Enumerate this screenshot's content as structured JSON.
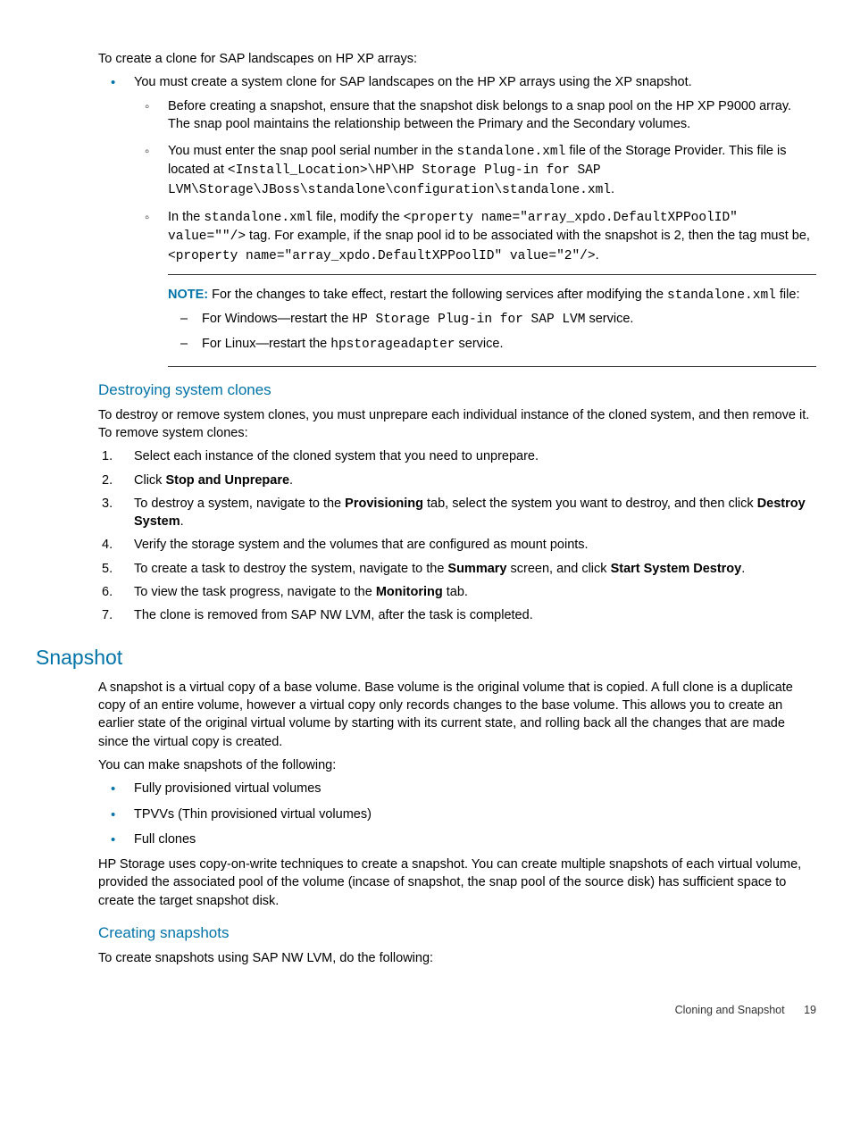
{
  "intro": {
    "p1": "To create a clone for SAP landscapes on HP XP arrays:",
    "b1": "You must create a system clone for SAP landscapes on the HP XP arrays using the XP snapshot.",
    "sub1": "Before creating a snapshot, ensure that the snapshot disk belongs to a snap pool on the HP XP P9000 array. The snap pool maintains the relationship between the Primary and the Secondary volumes.",
    "sub2a": "You must enter the snap pool serial number in the ",
    "sub2_code1": "standalone.xml",
    "sub2b": " file of the Storage Provider. This file is located at ",
    "sub2_code2": "<Install_Location>\\HP\\HP Storage Plug-in for SAP LVM\\Storage\\JBoss\\standalone\\configuration\\standalone.xml",
    "sub2c": ".",
    "sub3a": "In the ",
    "sub3_code1": "standalone.xml",
    "sub3b": " file, modify the ",
    "sub3_code2": "<property name=\"array_xpdo.DefaultXPPoolID\" value=\"\"/>",
    "sub3c": " tag. For example, if the snap pool id to be associated with the snapshot is 2, then the tag must be, ",
    "sub3_code3": "<property name=\"array_xpdo.DefaultXPPoolID\" value=\"2\"/>",
    "sub3d": ".",
    "note_label": "NOTE:",
    "note_text_a": "   For the changes to take effect, restart the following services after modifying the ",
    "note_code": "standalone.xml",
    "note_text_b": " file:",
    "dash1a": "For Windows—restart the ",
    "dash1_code": "HP Storage Plug-in for SAP LVM",
    "dash1b": " service.",
    "dash2a": "For Linux—restart the ",
    "dash2_code": "hpstorageadapter",
    "dash2b": " service."
  },
  "destroy": {
    "heading": "Destroying system clones",
    "p1": "To destroy or remove system clones, you must unprepare each individual instance of the cloned system, and then remove it. To remove system clones:",
    "li1": "Select each instance of the cloned system that you need to unprepare.",
    "li2a": "Click ",
    "li2_bold": "Stop and Unprepare",
    "li2b": ".",
    "li3a": "To destroy a system, navigate to the ",
    "li3_bold1": "Provisioning",
    "li3b": " tab, select the system you want to destroy, and then click ",
    "li3_bold2": "Destroy System",
    "li3c": ".",
    "li4": "Verify the storage system and the volumes that are configured as mount points.",
    "li5a": "To create a task to destroy the system, navigate to the ",
    "li5_bold1": "Summary",
    "li5b": " screen, and click ",
    "li5_bold2": "Start System Destroy",
    "li5c": ".",
    "li6a": "To view the task progress, navigate to the ",
    "li6_bold": "Monitoring",
    "li6b": " tab.",
    "li7": "The clone is removed from SAP NW LVM, after the task is completed."
  },
  "snapshot": {
    "heading": "Snapshot",
    "p1": "A snapshot is a virtual copy of a base volume. Base volume is the original volume that is copied. A full clone is a duplicate copy of an entire volume, however a virtual copy only records changes to the base volume. This allows you to create an earlier state of the original virtual volume by starting with its current state, and rolling back all the changes that are made since the virtual copy is created.",
    "p2": "You can make snapshots of the following:",
    "b1": "Fully provisioned virtual volumes",
    "b2": "TPVVs (Thin provisioned virtual volumes)",
    "b3": "Full clones",
    "p3": "HP Storage uses copy-on-write techniques to create a snapshot. You can create multiple snapshots of each virtual volume, provided the associated pool of the volume (incase of snapshot, the snap pool of the source disk) has sufficient space to create the target snapshot disk."
  },
  "creating": {
    "heading": "Creating snapshots",
    "p1": "To create snapshots using SAP NW LVM, do the following:"
  },
  "footer": {
    "text": "Cloning and Snapshot",
    "page": "19"
  }
}
